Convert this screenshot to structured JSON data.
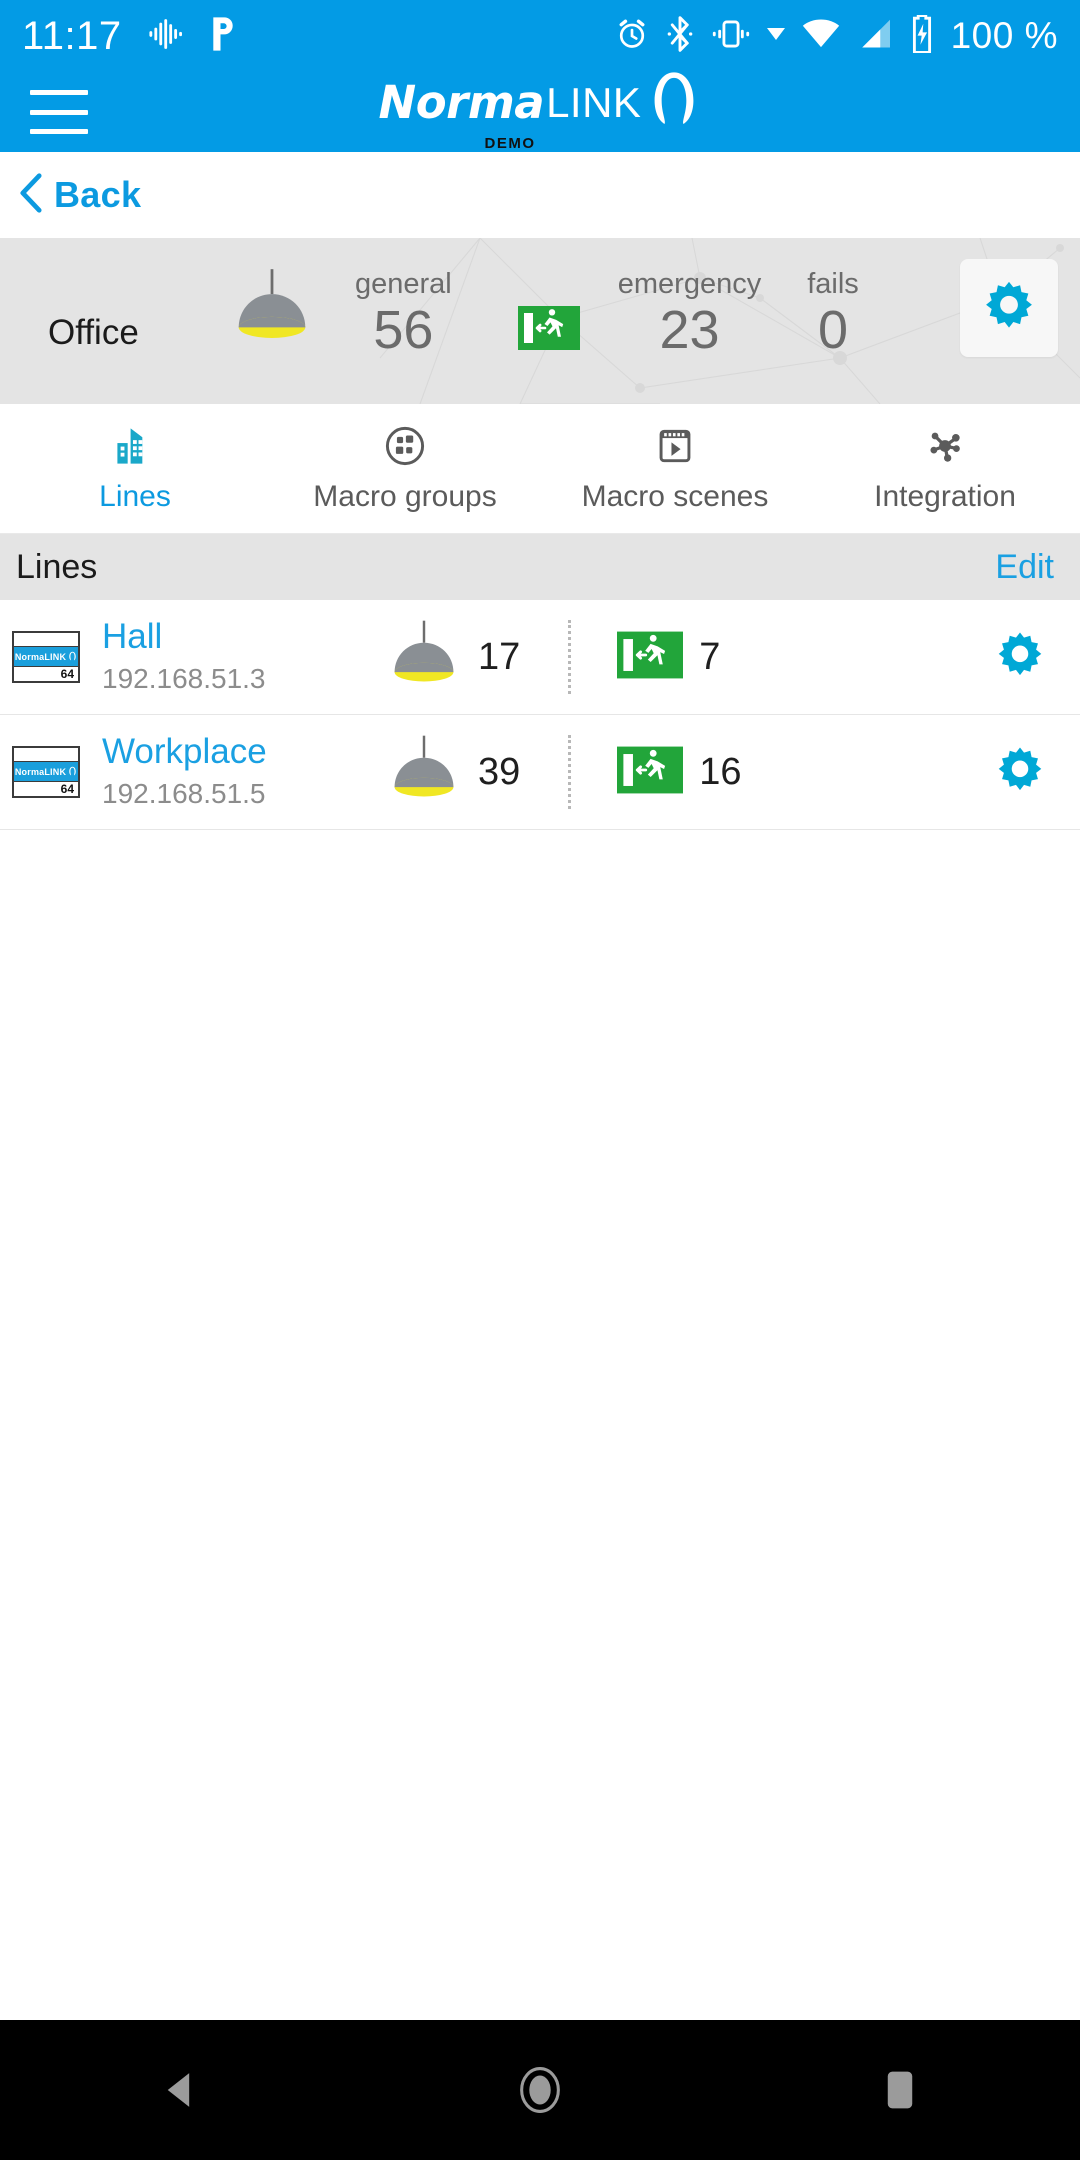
{
  "status_bar": {
    "time": "11:17",
    "battery_text": "100 %",
    "icons_left": [
      "equalizer-icon",
      "pandora-p-icon"
    ],
    "icons_right": [
      "alarm-clock-icon",
      "bluetooth-icon",
      "vibrate-icon",
      "dropdown-caret-icon",
      "wifi-icon",
      "cellular-signal-icon",
      "battery-charging-icon"
    ],
    "background_color": "#039BE5"
  },
  "app_bar": {
    "menu_icon": "hamburger-menu-icon",
    "brand_primary": "Norma",
    "brand_secondary": "LINK",
    "brand_mark": "arch-logo-icon",
    "brand_subtitle": "DEMO",
    "background_color": "#039BE5"
  },
  "back_nav": {
    "chevron_icon": "chevron-left-icon",
    "label": "Back",
    "color": "#0c9ae0"
  },
  "summary": {
    "title": "Office",
    "background_color": "#e4e4e4",
    "metrics": [
      {
        "key": "general",
        "label": "general",
        "value": "56",
        "icon": "pendant-lamp-icon"
      },
      {
        "key": "emergency",
        "label": "emergency",
        "value": "23",
        "icon": "emergency-exit-icon"
      },
      {
        "key": "fails",
        "label": "fails",
        "value": "0",
        "icon": ""
      }
    ],
    "settings_button": "gear-icon"
  },
  "tabs": [
    {
      "label": "Lines",
      "icon": "buildings-icon",
      "active": true
    },
    {
      "label": "Macro groups",
      "icon": "macro-groups-icon",
      "active": false
    },
    {
      "label": "Macro scenes",
      "icon": "macro-scenes-icon",
      "active": false
    },
    {
      "label": "Integration",
      "icon": "network-nodes-icon",
      "active": false
    }
  ],
  "section": {
    "title": "Lines",
    "action_label": "Edit",
    "action_color": "#1aa0e2"
  },
  "lines": [
    {
      "name": "Hall",
      "ip": "192.168.51.3",
      "general_count": "17",
      "emergency_count": "7",
      "thumb_label": "NormaLINK",
      "thumb_number": "64",
      "gear_icon": "gear-icon"
    },
    {
      "name": "Workplace",
      "ip": "192.168.51.5",
      "general_count": "39",
      "emergency_count": "16",
      "thumb_label": "NormaLINK",
      "thumb_number": "64",
      "gear_icon": "gear-icon"
    }
  ],
  "nav_bar": {
    "background_color": "#000000",
    "buttons": [
      {
        "name": "back-triangle-icon"
      },
      {
        "name": "home-circle-icon"
      },
      {
        "name": "recents-square-icon"
      }
    ]
  },
  "theme": {
    "accent": "#039BE5",
    "link": "#1aa0e2",
    "lamp_shade": "#8a8f94",
    "lamp_glow": "#f0e724",
    "exit_green": "#22a53a",
    "gear_teal": "#00a8d6"
  }
}
